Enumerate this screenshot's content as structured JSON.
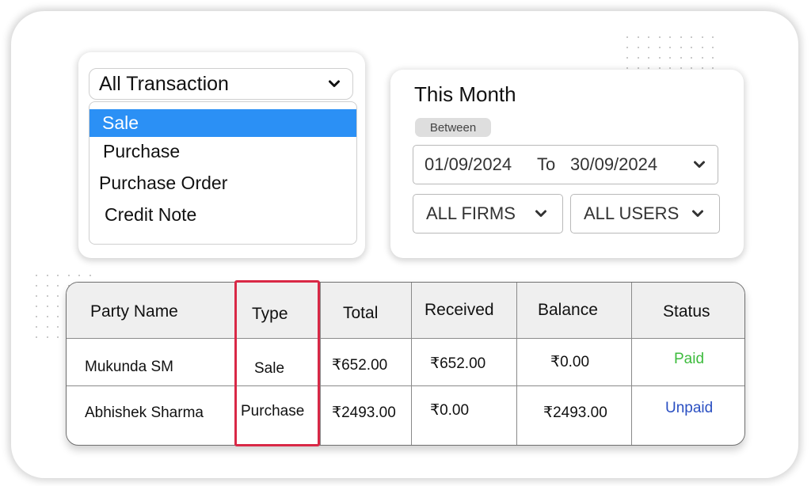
{
  "transaction_filter": {
    "selected_label": "All Transaction",
    "options": [
      {
        "label": "Sale",
        "selected": true
      },
      {
        "label": "Purchase",
        "selected": false
      },
      {
        "label": "Purchase Order",
        "selected": false
      },
      {
        "label": "Credit Note",
        "selected": false
      }
    ]
  },
  "date_filter": {
    "title": "This Month",
    "range_mode": "Between",
    "from_date": "01/09/2024",
    "to_word": "To",
    "to_date": "30/09/2024",
    "firms_label": "ALL FIRMS",
    "users_label": "ALL USERS"
  },
  "table": {
    "headers": [
      "Party Name",
      "Type",
      "Total",
      "Received",
      "Balance",
      "Status"
    ],
    "rows": [
      {
        "party": "Mukunda SM",
        "type": "Sale",
        "total": "₹652.00",
        "received": "₹652.00",
        "balance": "₹0.00",
        "status": "Paid"
      },
      {
        "party": "Abhishek Sharma",
        "type": "Purchase",
        "total": "₹2493.00",
        "received": "₹0.00",
        "balance": "₹2493.00",
        "status": "Unpaid"
      }
    ]
  },
  "colors": {
    "selected_option_bg": "#2b90f5",
    "highlight_border": "#d92846",
    "status_paid": "#3dbb3d",
    "status_unpaid": "#2a4fc2"
  },
  "icons": {
    "dropdown": "chevron-down-icon"
  }
}
